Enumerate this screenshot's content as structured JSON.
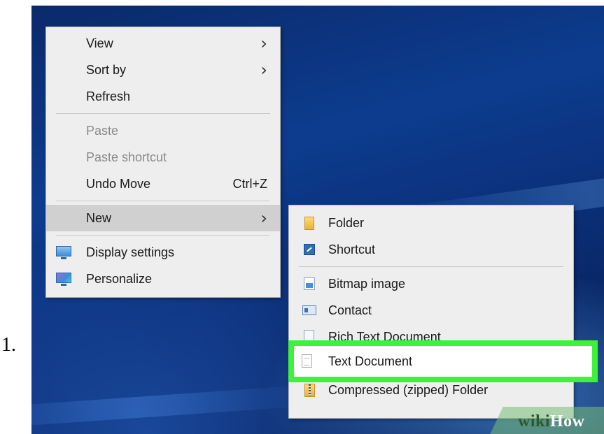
{
  "step_number": "1.",
  "context_menu": {
    "items": [
      {
        "label": "View",
        "submenu": true
      },
      {
        "label": "Sort by",
        "submenu": true
      },
      {
        "label": "Refresh"
      },
      {
        "label": "Paste",
        "disabled": true
      },
      {
        "label": "Paste shortcut",
        "disabled": true
      },
      {
        "label": "Undo Move",
        "shortcut": "Ctrl+Z"
      },
      {
        "label": "New",
        "submenu": true,
        "active": true
      },
      {
        "label": "Display settings",
        "icon": "display-icon"
      },
      {
        "label": "Personalize",
        "icon": "personalize-icon"
      }
    ]
  },
  "new_submenu": {
    "items": [
      {
        "label": "Folder",
        "icon": "folder-icon"
      },
      {
        "label": "Shortcut",
        "icon": "shortcut-icon"
      },
      {
        "label": "Bitmap image",
        "icon": "bitmap-icon"
      },
      {
        "label": "Contact",
        "icon": "contact-icon"
      },
      {
        "label": "Rich Text Document",
        "icon": "rich-text-icon"
      },
      {
        "label": "Text Document",
        "icon": "text-document-icon",
        "highlighted": true
      },
      {
        "label": "Compressed (zipped) Folder",
        "icon": "zip-folder-icon"
      }
    ]
  },
  "highlight_color": "#3ef23a",
  "watermark": {
    "part1": "wiki",
    "part2": "How"
  }
}
